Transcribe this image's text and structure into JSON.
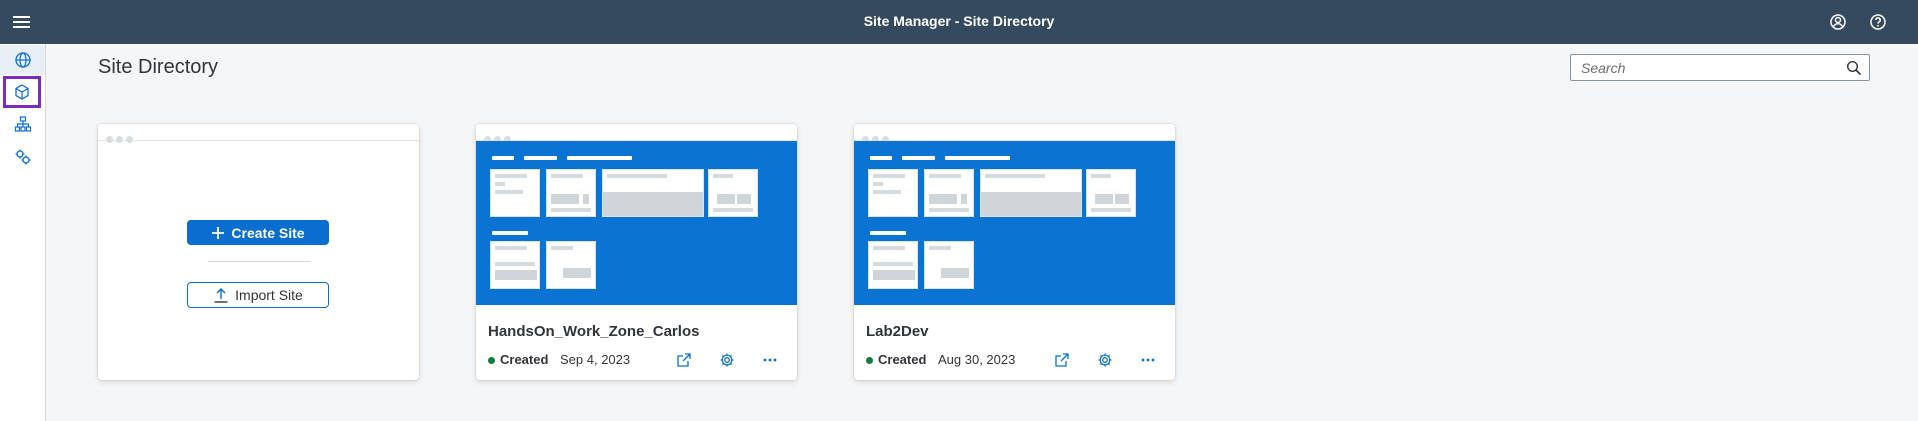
{
  "shell": {
    "title": "Site Manager - Site Directory",
    "icons": [
      "menu-icon",
      "user-icon",
      "help-icon"
    ]
  },
  "sidenav": {
    "items": [
      {
        "name": "site-directory",
        "icon": "globe-icon",
        "active": true
      },
      {
        "name": "content-manager",
        "icon": "cube-icon",
        "focused": true
      },
      {
        "name": "channel-manager",
        "icon": "hierarchy-icon"
      },
      {
        "name": "settings",
        "icon": "settings-icon"
      }
    ]
  },
  "page": {
    "title": "Site Directory",
    "search_placeholder": "Search"
  },
  "create_card": {
    "create_label": "Create Site",
    "import_label": "Import Site"
  },
  "sites": [
    {
      "name": "HandsOn_Work_Zone_Carlos",
      "status": "Created",
      "date": "Sep 4, 2023"
    },
    {
      "name": "Lab2Dev",
      "status": "Created",
      "date": "Aug 30, 2023"
    }
  ],
  "colors": {
    "shell": "#354a5f",
    "accent": "#0a6ed1",
    "thumbnail": "#0b74d3",
    "status_created": "#107e3e",
    "focus_outline": "#7b2cbf"
  }
}
